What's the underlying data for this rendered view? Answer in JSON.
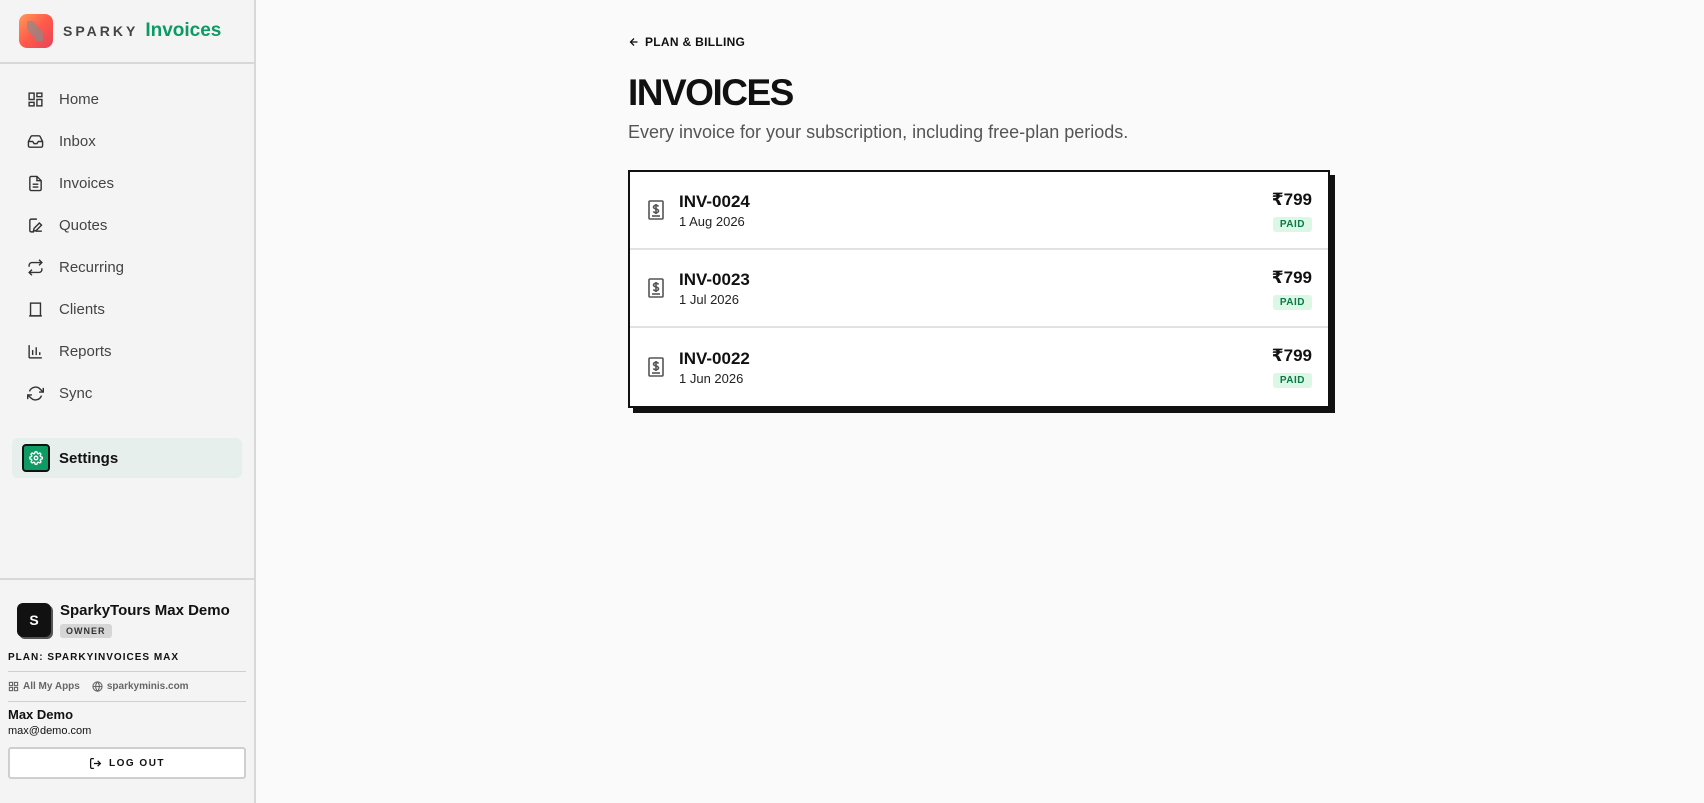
{
  "brand": {
    "sparky": "SPARKY",
    "product": "Invoices"
  },
  "nav": [
    {
      "label": "Home",
      "icon": "home-icon"
    },
    {
      "label": "Inbox",
      "icon": "inbox-icon"
    },
    {
      "label": "Invoices",
      "icon": "file-icon"
    },
    {
      "label": "Quotes",
      "icon": "edit-icon"
    },
    {
      "label": "Recurring",
      "icon": "repeat-icon"
    },
    {
      "label": "Clients",
      "icon": "building-icon"
    },
    {
      "label": "Reports",
      "icon": "bar-chart-icon"
    },
    {
      "label": "Sync",
      "icon": "refresh-icon"
    }
  ],
  "settings": {
    "label": "Settings",
    "icon": "gear-icon"
  },
  "account": {
    "org_initial": "S",
    "org_name": "SparkyTours Max Demo",
    "role": "OWNER",
    "plan": "PLAN: SPARKYINVOICES MAX",
    "links": {
      "apps": "All My Apps",
      "site": "sparkyminis.com"
    },
    "user_name": "Max Demo",
    "user_email": "max@demo.com",
    "logout": "LOG OUT"
  },
  "page": {
    "back": "PLAN & BILLING",
    "title": "INVOICES",
    "subtitle": "Every invoice for your subscription, including free-plan periods."
  },
  "invoices": [
    {
      "id": "INV-0024",
      "date": "1 Aug 2026",
      "amount": "₹799",
      "status": "PAID"
    },
    {
      "id": "INV-0023",
      "date": "1 Jul 2026",
      "amount": "₹799",
      "status": "PAID"
    },
    {
      "id": "INV-0022",
      "date": "1 Jun 2026",
      "amount": "₹799",
      "status": "PAID"
    }
  ],
  "colors": {
    "brand_green": "#0d9a63",
    "paid_bg": "#dcf7e6",
    "paid_text": "#0a7a45"
  }
}
